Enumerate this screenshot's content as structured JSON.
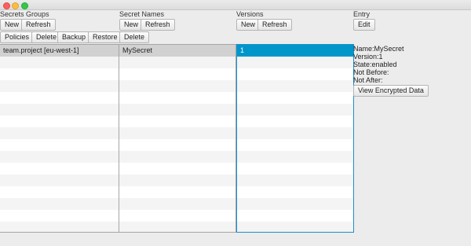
{
  "sections": {
    "secret_groups": "Secrets Groups",
    "secret_names": "Secret Names",
    "versions": "Versions",
    "entry": "Entry"
  },
  "groups_toolbar": {
    "new_label": "New",
    "refresh_label": "Refresh"
  },
  "groups_actions": {
    "policies_label": "Policies",
    "delete_label": "Delete",
    "backup_label": "Backup",
    "restore_label": "Restore"
  },
  "names_toolbar": {
    "new_label": "New",
    "refresh_label": "Refresh",
    "delete_label": "Delete"
  },
  "versions_toolbar": {
    "new_label": "New",
    "refresh_label": "Refresh"
  },
  "entry_toolbar": {
    "edit_label": "Edit"
  },
  "groups_list": [
    "team.project [eu-west-1]"
  ],
  "names_list": [
    "MySecret"
  ],
  "versions_list": [
    "1"
  ],
  "entry_details": {
    "name": "Name:MySecret",
    "version": "Version:1",
    "state": "State:enabled",
    "not_before": "Not Before:",
    "not_after": "Not After:",
    "view_encrypted_label": "View Encrypted Data"
  },
  "colors": {
    "selection_active": "#0096c9",
    "selection_inactive": "#d1d1d1",
    "focus_border": "#1a8fce"
  }
}
